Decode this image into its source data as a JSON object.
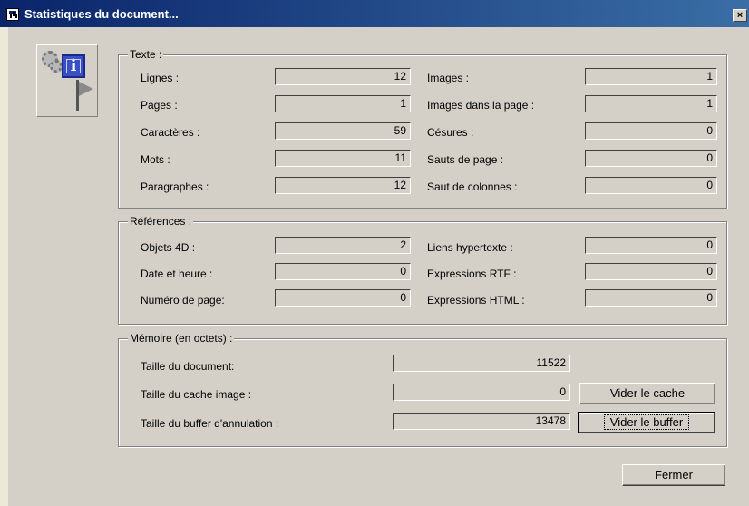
{
  "window": {
    "title": "Statistiques du document...",
    "close_label": "×"
  },
  "texte": {
    "legend": "Texte :",
    "left": [
      {
        "label": "Lignes :",
        "value": "12"
      },
      {
        "label": "Pages :",
        "value": "1"
      },
      {
        "label": "Caractères :",
        "value": "59"
      },
      {
        "label": "Mots :",
        "value": "11"
      },
      {
        "label": "Paragraphes :",
        "value": "12"
      }
    ],
    "right": [
      {
        "label": "Images :",
        "value": "1"
      },
      {
        "label": "Images dans la page :",
        "value": "1"
      },
      {
        "label": "Césures :",
        "value": "0"
      },
      {
        "label": "Sauts de page :",
        "value": "0"
      },
      {
        "label": "Saut de colonnes :",
        "value": "0"
      }
    ]
  },
  "references": {
    "legend": "Références :",
    "left": [
      {
        "label": "Objets 4D :",
        "value": "2"
      },
      {
        "label": "Date et heure :",
        "value": "0"
      },
      {
        "label": "Numéro de page:",
        "value": "0"
      }
    ],
    "right": [
      {
        "label": "Liens hypertexte :",
        "value": "0"
      },
      {
        "label": "Expressions RTF :",
        "value": "0"
      },
      {
        "label": "Expressions HTML :",
        "value": "0"
      }
    ]
  },
  "memoire": {
    "legend": "Mémoire (en octets) :",
    "rows": [
      {
        "label": "Taille du document:",
        "value": "11522"
      },
      {
        "label": "Taille du cache image :",
        "value": "0"
      },
      {
        "label": "Taille du buffer d'annulation :",
        "value": "13478"
      }
    ],
    "clear_cache_button": "Vider le cache",
    "clear_buffer_button": "Vider le buffer"
  },
  "footer": {
    "close_button": "Fermer"
  },
  "icons": {
    "app_icon": "document-stats-icon",
    "logo": "info-gears-icon",
    "close": "close-icon"
  }
}
